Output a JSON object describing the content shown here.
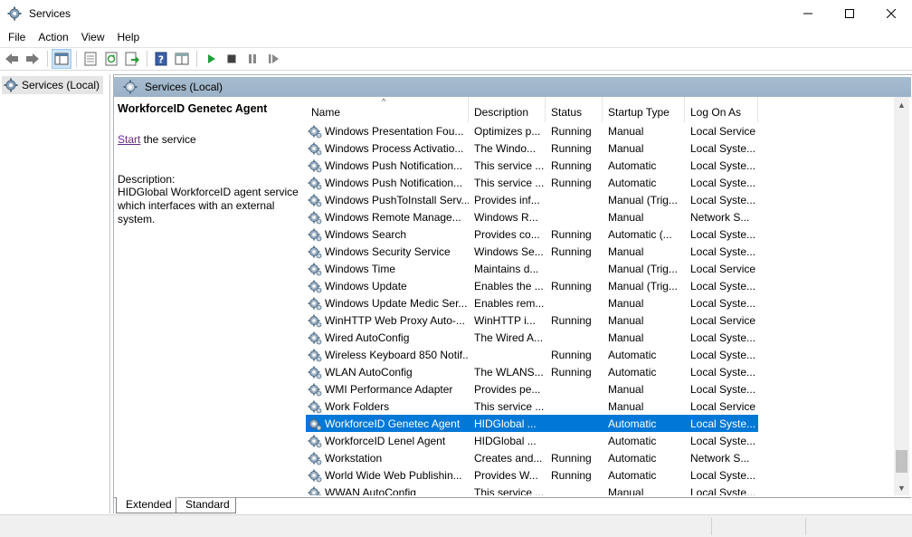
{
  "window": {
    "title": "Services"
  },
  "menu": [
    "File",
    "Action",
    "View",
    "Help"
  ],
  "tree": {
    "label": "Services (Local)"
  },
  "header": {
    "label": "Services (Local)"
  },
  "details": {
    "title": "WorkforceID Genetec Agent",
    "start_link": "Start",
    "start_suffix": " the service",
    "description_label": "Description:",
    "description": "HIDGlobal WorkforceID agent service which interfaces with an external system."
  },
  "columns": {
    "name": "Name",
    "description": "Description",
    "status": "Status",
    "startup": "Startup Type",
    "logon": "Log On As"
  },
  "rows": [
    {
      "name": "Windows Presentation Fou...",
      "description": "Optimizes p...",
      "status": "Running",
      "startup": "Manual",
      "logon": "Local Service",
      "selected": false
    },
    {
      "name": "Windows Process Activatio...",
      "description": "The Windo...",
      "status": "Running",
      "startup": "Manual",
      "logon": "Local Syste...",
      "selected": false
    },
    {
      "name": "Windows Push Notification...",
      "description": "This service ...",
      "status": "Running",
      "startup": "Automatic",
      "logon": "Local Syste...",
      "selected": false
    },
    {
      "name": "Windows Push Notification...",
      "description": "This service ...",
      "status": "Running",
      "startup": "Automatic",
      "logon": "Local Syste...",
      "selected": false
    },
    {
      "name": "Windows PushToInstall Serv...",
      "description": "Provides inf...",
      "status": "",
      "startup": "Manual (Trig...",
      "logon": "Local Syste...",
      "selected": false
    },
    {
      "name": "Windows Remote Manage...",
      "description": "Windows R...",
      "status": "",
      "startup": "Manual",
      "logon": "Network S...",
      "selected": false
    },
    {
      "name": "Windows Search",
      "description": "Provides co...",
      "status": "Running",
      "startup": "Automatic (...",
      "logon": "Local Syste...",
      "selected": false
    },
    {
      "name": "Windows Security Service",
      "description": "Windows Se...",
      "status": "Running",
      "startup": "Manual",
      "logon": "Local Syste...",
      "selected": false
    },
    {
      "name": "Windows Time",
      "description": "Maintains d...",
      "status": "",
      "startup": "Manual (Trig...",
      "logon": "Local Service",
      "selected": false
    },
    {
      "name": "Windows Update",
      "description": "Enables the ...",
      "status": "Running",
      "startup": "Manual (Trig...",
      "logon": "Local Syste...",
      "selected": false
    },
    {
      "name": "Windows Update Medic Ser...",
      "description": "Enables rem...",
      "status": "",
      "startup": "Manual",
      "logon": "Local Syste...",
      "selected": false
    },
    {
      "name": "WinHTTP Web Proxy Auto-...",
      "description": "WinHTTP i...",
      "status": "Running",
      "startup": "Manual",
      "logon": "Local Service",
      "selected": false
    },
    {
      "name": "Wired AutoConfig",
      "description": "The Wired A...",
      "status": "",
      "startup": "Manual",
      "logon": "Local Syste...",
      "selected": false
    },
    {
      "name": "Wireless Keyboard 850 Notif...",
      "description": "",
      "status": "Running",
      "startup": "Automatic",
      "logon": "Local Syste...",
      "selected": false
    },
    {
      "name": "WLAN AutoConfig",
      "description": "The WLANS...",
      "status": "Running",
      "startup": "Automatic",
      "logon": "Local Syste...",
      "selected": false
    },
    {
      "name": "WMI Performance Adapter",
      "description": "Provides pe...",
      "status": "",
      "startup": "Manual",
      "logon": "Local Syste...",
      "selected": false
    },
    {
      "name": "Work Folders",
      "description": "This service ...",
      "status": "",
      "startup": "Manual",
      "logon": "Local Service",
      "selected": false
    },
    {
      "name": "WorkforceID Genetec Agent",
      "description": "HIDGlobal ...",
      "status": "",
      "startup": "Automatic",
      "logon": "Local Syste...",
      "selected": true
    },
    {
      "name": "WorkforceID Lenel Agent",
      "description": "HIDGlobal ...",
      "status": "",
      "startup": "Automatic",
      "logon": "Local Syste...",
      "selected": false
    },
    {
      "name": "Workstation",
      "description": "Creates and...",
      "status": "Running",
      "startup": "Automatic",
      "logon": "Network S...",
      "selected": false
    },
    {
      "name": "World Wide Web Publishin...",
      "description": "Provides W...",
      "status": "Running",
      "startup": "Automatic",
      "logon": "Local Syste...",
      "selected": false
    },
    {
      "name": "WWAN AutoConfig",
      "description": "This service ...",
      "status": "",
      "startup": "Manual",
      "logon": "Local Syste...",
      "selected": false
    }
  ],
  "tabs": [
    "Extended",
    "Standard"
  ],
  "colors": {
    "selection": "#0078d7",
    "header_band": "#a7bccf",
    "link": "#6b2a86"
  },
  "icons": [
    "services-gear-icon",
    "back-icon",
    "forward-icon",
    "console-tree-icon",
    "properties-icon",
    "refresh-icon",
    "export-icon",
    "help-icon",
    "view-icon",
    "play-icon",
    "stop-icon",
    "pause-icon",
    "resume-icon"
  ]
}
